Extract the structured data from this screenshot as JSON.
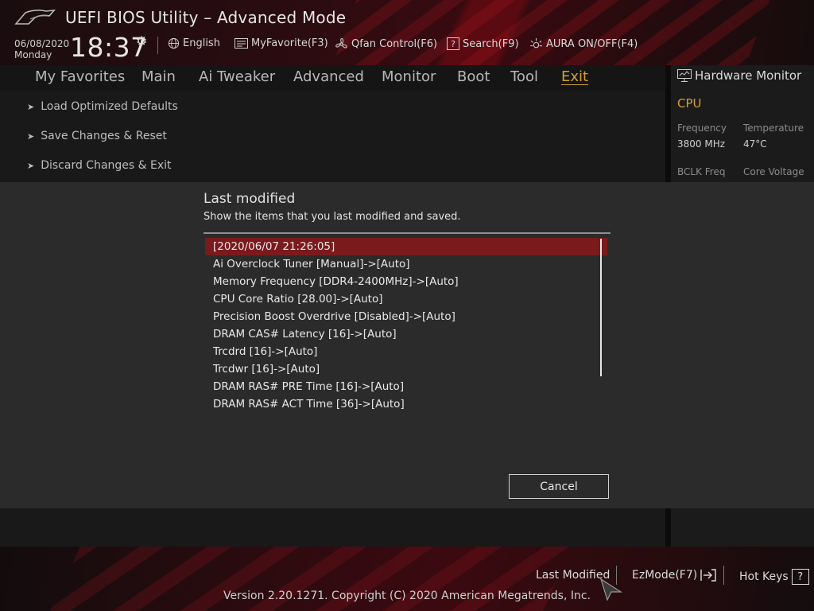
{
  "header": {
    "title": "UEFI BIOS Utility – Advanced Mode",
    "date": "06/08/2020",
    "weekday": "Monday",
    "time": "18:37",
    "tools": {
      "language": "English",
      "myfavorite": "MyFavorite(F3)",
      "qfan": "Qfan Control(F6)",
      "search": "Search(F9)",
      "aura": "AURA ON/OFF(F4)"
    }
  },
  "nav": {
    "tabs": [
      "My Favorites",
      "Main",
      "Ai Tweaker",
      "Advanced",
      "Monitor",
      "Boot",
      "Tool",
      "Exit"
    ],
    "active": "Exit"
  },
  "exit_menu": [
    "Load Optimized Defaults",
    "Save Changes & Reset",
    "Discard Changes & Exit"
  ],
  "hardware_monitor": {
    "title": "Hardware Monitor",
    "section": "CPU",
    "frequency_label": "Frequency",
    "frequency_value": "3800 MHz",
    "temperature_label": "Temperature",
    "temperature_value": "47°C",
    "bclk_label": "BCLK Freq",
    "core_voltage_label": "Core Voltage"
  },
  "dialog": {
    "title": "Last modified",
    "subtitle": "Show the items that you last modified and saved.",
    "items": [
      "[2020/06/07 21:26:05]",
      "Ai Overclock Tuner [Manual]->[Auto]",
      "Memory Frequency [DDR4-2400MHz]->[Auto]",
      "CPU Core Ratio [28.00]->[Auto]",
      "Precision Boost Overdrive [Disabled]->[Auto]",
      "DRAM CAS# Latency [16]->[Auto]",
      "Trcdrd [16]->[Auto]",
      "Trcdwr [16]->[Auto]",
      "DRAM RAS# PRE Time [16]->[Auto]",
      "DRAM RAS# ACT Time [36]->[Auto]"
    ],
    "selected_index": 0,
    "cancel_label": "Cancel"
  },
  "footer": {
    "last_modified": "Last Modified",
    "ezmode": "EzMode(F7)",
    "hotkeys": "Hot Keys",
    "hotkeys_glyph": "?",
    "copyright": "Version 2.20.1271. Copyright (C) 2020 American Megatrends, Inc."
  },
  "colors": {
    "accent_gold": "#d4a033",
    "selection_red": "#7a1a1d",
    "dialog_bg": "#2b2b2b"
  }
}
